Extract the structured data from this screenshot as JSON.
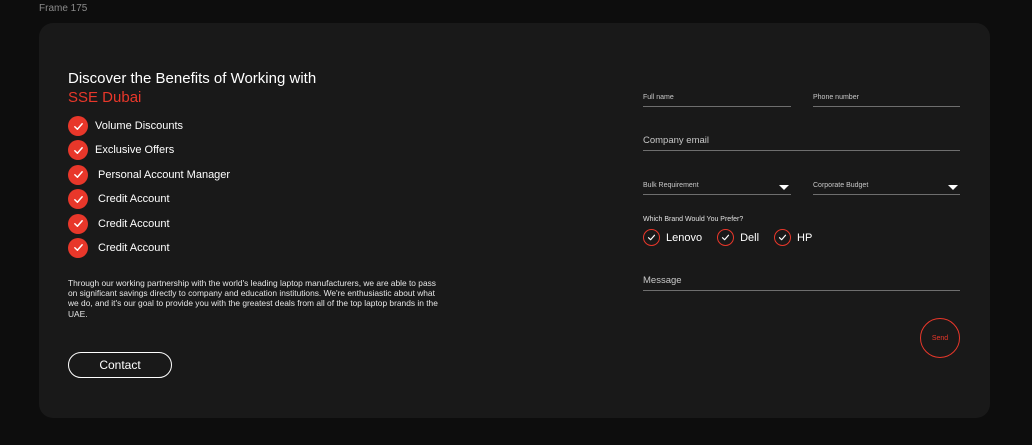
{
  "frame": {
    "label": "Frame 175"
  },
  "hero": {
    "heading_line1": "Discover the Benefits of Working with",
    "heading_accent": "SSE Dubai"
  },
  "benefits": [
    {
      "label": "Volume Discounts"
    },
    {
      "label": "Exclusive Offers"
    },
    {
      "label": "Personal Account Manager"
    },
    {
      "label": "Credit Account"
    },
    {
      "label": "Credit Account"
    },
    {
      "label": "Credit Account"
    }
  ],
  "description": "Through our working partnership with the world's leading laptop manufacturers, we are able to pass on significant savings directly to company and education institutions. We're enthusiastic about what we do, and it's our goal to provide you with the greatest deals from all of the top laptop brands in the UAE.",
  "contact_button": "Contact",
  "form": {
    "full_name": {
      "placeholder": "Full name",
      "value": ""
    },
    "phone_number": {
      "placeholder": "Phone number",
      "value": ""
    },
    "company_email": {
      "placeholder": "Company email",
      "value": ""
    },
    "bulk_requirement": {
      "placeholder": "Bulk Requirement"
    },
    "corporate_budget": {
      "placeholder": "Corporate Budget"
    },
    "brand_question": "Which Brand Would You Prefer?",
    "brands": [
      {
        "label": "Lenovo",
        "checked": true
      },
      {
        "label": "Dell",
        "checked": true
      },
      {
        "label": "HP",
        "checked": true
      }
    ],
    "message": {
      "placeholder": "Message",
      "value": ""
    },
    "send_label": "Send"
  },
  "colors": {
    "accent": "#e8372a",
    "background": "#0d0d0d",
    "card": "#191919"
  }
}
